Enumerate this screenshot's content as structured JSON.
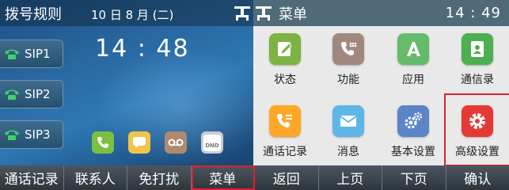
{
  "left_screen": {
    "title": "拨号规则",
    "date": "10 日 8 月 (二)",
    "clock": "14 : 48",
    "lines": [
      {
        "label": "SIP1"
      },
      {
        "label": "SIP2"
      },
      {
        "label": "SIP3"
      }
    ],
    "dock_icons": [
      "phone-icon",
      "message-icon",
      "voicemail-icon",
      "dnd-icon"
    ],
    "dnd_text": "DND"
  },
  "right_screen": {
    "title": "菜单",
    "time": "14 : 49",
    "menu": [
      {
        "label": "状态",
        "icon": "status-icon",
        "color": "#7cb342"
      },
      {
        "label": "功能",
        "icon": "features-icon",
        "color": "#a1887f"
      },
      {
        "label": "应用",
        "icon": "apps-icon",
        "color": "#66bb6a"
      },
      {
        "label": "通信录",
        "icon": "contacts-icon",
        "color": "#4caf50"
      },
      {
        "label": "通话记录",
        "icon": "call-history-icon",
        "color": "#ffa726"
      },
      {
        "label": "消息",
        "icon": "message-icon",
        "color": "#5eb6e8"
      },
      {
        "label": "基本设置",
        "icon": "basic-settings-icon",
        "color": "#5c85c7"
      },
      {
        "label": "高级设置",
        "icon": "advanced-settings-icon",
        "color": "#e53935",
        "highlighted": true
      }
    ]
  },
  "softkeys_left": [
    "通话记录",
    "联系人",
    "免打扰",
    "菜单"
  ],
  "softkeys_right": [
    "返回",
    "上页",
    "下页",
    "确认"
  ],
  "highlight_color": "#e0202a"
}
